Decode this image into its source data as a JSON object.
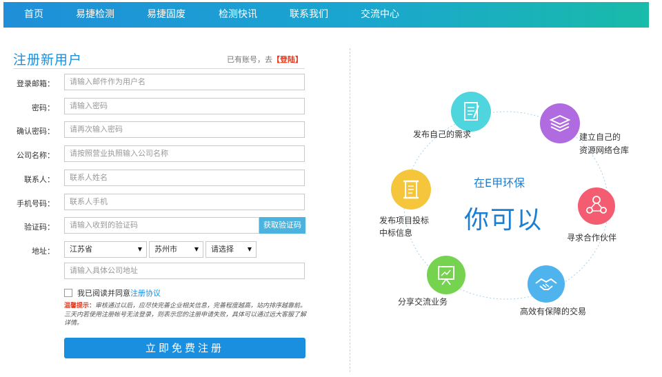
{
  "nav": {
    "items": [
      "首页",
      "易捷检测",
      "易捷固废",
      "检测快讯",
      "联系我们",
      "交流中心"
    ]
  },
  "form": {
    "title": "注册新用户",
    "have_account_text": "已有账号，去",
    "login_link": "【登陆】",
    "fields": [
      {
        "label": "登录邮箱：",
        "placeholder": "请输入邮件作为用户名"
      },
      {
        "label": "密码：",
        "placeholder": "请输入密码"
      },
      {
        "label": "确认密码：",
        "placeholder": "请再次输入密码"
      },
      {
        "label": "公司名称：",
        "placeholder": "请按照营业执照输入公司名称"
      },
      {
        "label": "联系人：",
        "placeholder": "联系人姓名"
      },
      {
        "label": "手机号码：",
        "placeholder": "联系人手机"
      },
      {
        "label": "验证码：",
        "placeholder": "请输入收到的验证码"
      }
    ],
    "sms_button": "获取验证码",
    "address_label": "地址：",
    "province": "江苏省",
    "city": "苏州市",
    "district": "请选择",
    "address_placeholder": "请输入具体公司地址",
    "agree_text": "我已阅读并同意",
    "agree_link": "注册协议",
    "notice_lead": "温馨提示：",
    "notice_text": "审核通过以后，应尽快完善企业相关信息，完善程度越高，站内排序越靠前。三天内若使用注册帐号无法登录，则表示您的注册申请失败，具体可以通过远大客服了解详情。",
    "submit": "立即免费注册"
  },
  "diagram": {
    "center_sub": "在E甲环保",
    "center_main": "你可以",
    "features": [
      {
        "label": "发布自己的需求",
        "icon": "document-icon",
        "color": "#4fd5de"
      },
      {
        "label": "建立自己的",
        "label2": "资源网络仓库",
        "icon": "database-icon",
        "color": "#b06be0"
      },
      {
        "label": "寻求合作伙伴",
        "icon": "network-icon",
        "color": "#f45d71"
      },
      {
        "label": "高效有保障的交易",
        "icon": "handshake-icon",
        "color": "#4fb3ee"
      },
      {
        "label": "分享交流业务",
        "icon": "presentation-icon",
        "color": "#76d34f"
      },
      {
        "label": "发布项目投标",
        "label2": "中标信息",
        "icon": "scroll-icon",
        "color": "#f5c53b"
      }
    ]
  }
}
